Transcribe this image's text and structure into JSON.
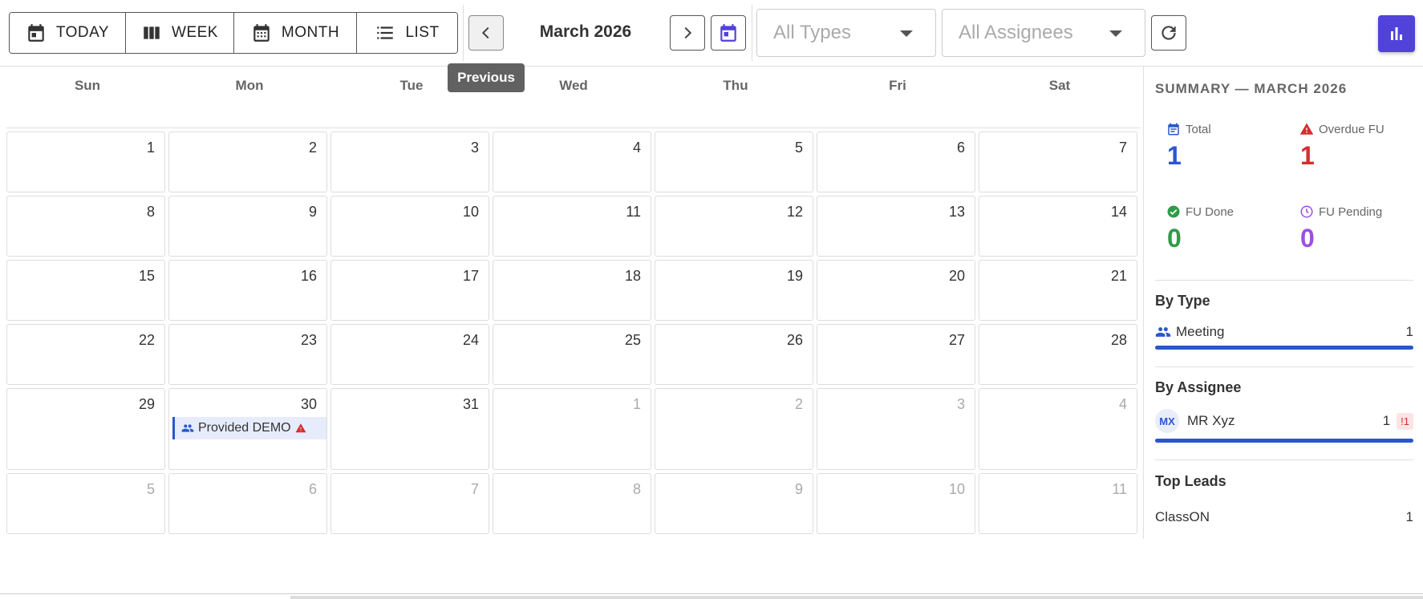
{
  "toolbar": {
    "views": [
      {
        "label": "TODAY",
        "icon": "calendar-today-icon"
      },
      {
        "label": "WEEK",
        "icon": "week-columns-icon"
      },
      {
        "label": "MONTH",
        "icon": "calendar-month-icon"
      },
      {
        "label": "LIST",
        "icon": "list-icon"
      }
    ],
    "month_title": "March 2026",
    "prev_icon": "chevron-left-icon",
    "next_icon": "chevron-right-icon",
    "picker_icon": "calendar-picker-icon",
    "type_filter": {
      "value": "All Types"
    },
    "assignee_filter": {
      "value": "All Assignees"
    },
    "refresh_icon": "refresh-icon",
    "tooltip": "Previous",
    "summary_toggle_icon": "bar-chart-icon"
  },
  "calendar": {
    "weekdays": [
      "Sun",
      "Mon",
      "Tue",
      "Wed",
      "Thu",
      "Fri",
      "Sat"
    ],
    "weeks": [
      [
        {
          "d": "1"
        },
        {
          "d": "2"
        },
        {
          "d": "3"
        },
        {
          "d": "4"
        },
        {
          "d": "5"
        },
        {
          "d": "6"
        },
        {
          "d": "7"
        }
      ],
      [
        {
          "d": "8"
        },
        {
          "d": "9"
        },
        {
          "d": "10"
        },
        {
          "d": "11"
        },
        {
          "d": "12"
        },
        {
          "d": "13"
        },
        {
          "d": "14"
        }
      ],
      [
        {
          "d": "15"
        },
        {
          "d": "16"
        },
        {
          "d": "17"
        },
        {
          "d": "18"
        },
        {
          "d": "19"
        },
        {
          "d": "20"
        },
        {
          "d": "21"
        }
      ],
      [
        {
          "d": "22"
        },
        {
          "d": "23"
        },
        {
          "d": "24"
        },
        {
          "d": "25"
        },
        {
          "d": "26"
        },
        {
          "d": "27"
        },
        {
          "d": "28"
        }
      ],
      [
        {
          "d": "29"
        },
        {
          "d": "30",
          "event": "Provided DEMO"
        },
        {
          "d": "31"
        },
        {
          "d": "1",
          "other": true
        },
        {
          "d": "2",
          "other": true
        },
        {
          "d": "3",
          "other": true
        },
        {
          "d": "4",
          "other": true
        }
      ],
      [
        {
          "d": "5",
          "other": true
        },
        {
          "d": "6",
          "other": true
        },
        {
          "d": "7",
          "other": true
        },
        {
          "d": "8",
          "other": true
        },
        {
          "d": "9",
          "other": true
        },
        {
          "d": "10",
          "other": true
        },
        {
          "d": "11",
          "other": true
        }
      ]
    ]
  },
  "summary": {
    "title": "SUMMARY — MARCH 2026",
    "stats": {
      "total": {
        "label": "Total",
        "value": "1",
        "color": "#2a57cf",
        "icon": "calendar-icon"
      },
      "overdue": {
        "label": "Overdue FU",
        "value": "1",
        "color": "#d32f2f",
        "icon": "warning-icon"
      },
      "done": {
        "label": "FU Done",
        "value": "0",
        "color": "#2e9b48",
        "icon": "check-circle-icon"
      },
      "pending": {
        "label": "FU Pending",
        "value": "0",
        "color": "#9b51e0",
        "icon": "clock-icon"
      }
    },
    "by_type": {
      "heading": "By Type",
      "items": [
        {
          "label": "Meeting",
          "count": "1",
          "share": 1.0,
          "icon": "group-icon"
        }
      ]
    },
    "by_assignee": {
      "heading": "By Assignee",
      "items": [
        {
          "initials": "MX",
          "name": "MR Xyz",
          "count": "1",
          "overdue": "!1",
          "share": 1.0
        }
      ]
    },
    "top_leads": {
      "heading": "Top Leads",
      "items": [
        {
          "name": "ClassON",
          "count": "1"
        }
      ]
    }
  }
}
